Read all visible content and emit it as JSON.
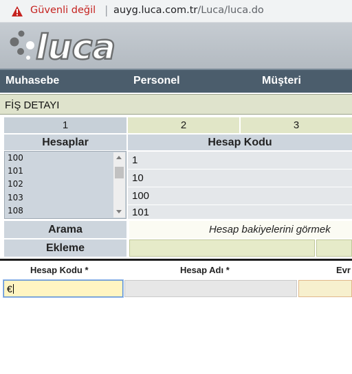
{
  "browser": {
    "security_text": "Güvenli değil",
    "separator": "|",
    "url_host": "auyg.luca.com.tr",
    "url_path": "/Luca/luca.do"
  },
  "logo": {
    "text": "luca"
  },
  "menu": {
    "items": [
      "Muhasebe",
      "Personel",
      "Müşteri"
    ]
  },
  "section": {
    "title": "FİŞ DETAYI"
  },
  "tabs": [
    "1",
    "2",
    "3"
  ],
  "lookup": {
    "accounts_label": "Hesaplar",
    "code_label": "Hesap Kodu",
    "accounts": [
      "100",
      "101",
      "102",
      "103",
      "108"
    ],
    "codes": [
      "1",
      "10",
      "100",
      "101"
    ],
    "search_label": "Arama",
    "search_hint": "Hesap bakiyelerini görmek",
    "add_label": "Ekleme"
  },
  "entry": {
    "col_code": "Hesap Kodu *",
    "col_name": "Hesap Adı *",
    "col_doc": "Evr",
    "code_value": "€"
  },
  "colors": {
    "menu_bg": "#4b5d6c",
    "section_bg": "#dfe3cc",
    "active_input": "#fff5c2",
    "warning_red": "#c5221f"
  }
}
